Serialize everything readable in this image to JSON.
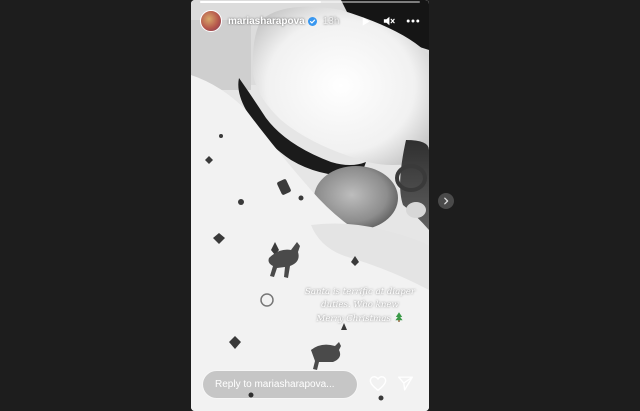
{
  "story": {
    "progress": 0.55,
    "user": {
      "username": "mariasharapova",
      "verified": true,
      "timestamp": "13h"
    },
    "controls": {
      "play_icon": "play-icon",
      "mute_icon": "volume-muted-icon",
      "more_icon": "more-options-icon"
    },
    "caption": {
      "line1": "Santa is terrific at diaper",
      "line2": "duties. Who knew",
      "line3": "Merry Christmas",
      "emoji": "christmas-tree"
    },
    "reply": {
      "placeholder": "Reply to mariasharapova..."
    },
    "actions": {
      "like_icon": "heart-icon",
      "share_icon": "send-icon"
    }
  },
  "navigation": {
    "next_icon": "chevron-right-icon"
  },
  "colors": {
    "page_background": "#1d1d1d",
    "story_text": "#ffffff",
    "verified_badge": "#3897f0",
    "tree": "#3b9a48"
  }
}
